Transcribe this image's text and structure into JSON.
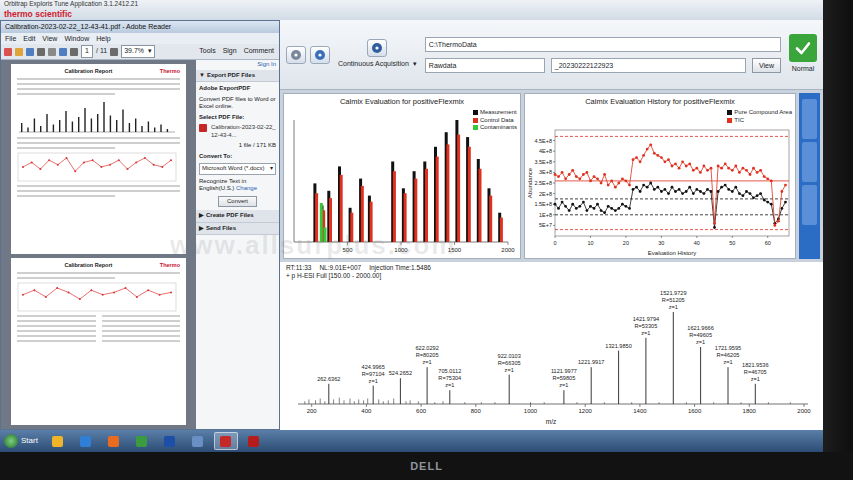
{
  "app": {
    "title": "Orbitrap Exploris Tune Application 3.1.2412.21",
    "logo": "thermo scientific",
    "toolbar": {
      "mode": "Continuous Acquisition",
      "mode_arrow": "▾",
      "path": "C:\\ThermoData",
      "file": "Rawdata",
      "suffix": "_20230222122923",
      "view_button": "View",
      "status": "Normal",
      "status_ok": true
    }
  },
  "reader": {
    "title": "Calibration-2023-02-22_12-43-41.pdf - Adobe Reader",
    "menu": [
      "File",
      "Edit",
      "View",
      "Window",
      "Help"
    ],
    "page": "1",
    "page_count": "/ 11",
    "zoom": "39.7%",
    "zoom_arrow": "▾",
    "tools": [
      "Tools",
      "Sign",
      "Comment"
    ],
    "pages": [
      {
        "title": "Calibration Report",
        "logo": "Thermo",
        "bars": [
          6,
          3,
          9,
          4,
          12,
          5,
          8,
          14,
          7,
          10,
          16,
          9,
          12,
          20,
          11,
          8,
          15,
          6,
          9,
          4,
          7,
          3,
          5,
          2
        ],
        "trend": [
          5,
          7,
          4,
          8,
          6,
          9,
          3,
          7,
          8,
          5,
          6,
          8,
          4,
          7,
          9,
          6,
          5,
          8
        ]
      },
      {
        "title": "Calibration Report",
        "logo": "Thermo",
        "bars": [],
        "trend": [
          6,
          8,
          5,
          9,
          7,
          4,
          8,
          6,
          7,
          9,
          5,
          8,
          6,
          7
        ]
      }
    ],
    "pane": {
      "sign_in": "Sign In",
      "sections": [
        {
          "label": "Export PDF Files",
          "arrow": "▼",
          "expanded": true
        },
        {
          "label": "Create PDF Files",
          "arrow": "▶",
          "expanded": false
        },
        {
          "label": "Send Files",
          "arrow": "▶",
          "expanded": false
        }
      ],
      "export": {
        "heading": "Adobe ExportPDF",
        "desc": "Convert PDF files to Word or Excel online.",
        "select_label": "Select PDF File:",
        "file": "Calibration-2023-02-22_12-43-4...",
        "file_info": "1 file / 171 KB",
        "convert_label": "Convert To:",
        "format": "Microsoft Word (*.docx)",
        "format_arrow": "▾",
        "recognize": "Recognize Text in English(U.S.)",
        "change": "Change",
        "button": "Convert"
      }
    }
  },
  "calmix": {
    "title": "Calmix Evaluation for positiveFlexmix",
    "x_ticks": [
      "500",
      "1000",
      "1500",
      "2000"
    ],
    "x_max": 2000,
    "y_max": 100,
    "series": [
      {
        "label": "Measurement",
        "color": "#111111",
        "points": [
          [
            195,
            48
          ],
          [
            262,
            30
          ],
          [
            325,
            42
          ],
          [
            425,
            62
          ],
          [
            524,
            28
          ],
          [
            622,
            52
          ],
          [
            705,
            38
          ],
          [
            922,
            66
          ],
          [
            1022,
            44
          ],
          [
            1122,
            58
          ],
          [
            1222,
            66
          ],
          [
            1322,
            78
          ],
          [
            1422,
            90
          ],
          [
            1522,
            100
          ],
          [
            1622,
            86
          ],
          [
            1722,
            68
          ],
          [
            1822,
            44
          ],
          [
            1922,
            24
          ]
        ]
      },
      {
        "label": "Control Data",
        "color": "#e0301e",
        "points": [
          [
            211,
            40
          ],
          [
            278,
            26
          ],
          [
            341,
            36
          ],
          [
            441,
            55
          ],
          [
            540,
            24
          ],
          [
            638,
            46
          ],
          [
            721,
            33
          ],
          [
            938,
            58
          ],
          [
            1038,
            40
          ],
          [
            1138,
            52
          ],
          [
            1238,
            60
          ],
          [
            1338,
            70
          ],
          [
            1438,
            80
          ],
          [
            1538,
            88
          ],
          [
            1638,
            78
          ],
          [
            1738,
            60
          ],
          [
            1838,
            38
          ],
          [
            1938,
            20
          ]
        ]
      },
      {
        "label": "Contaminants",
        "color": "#39c639",
        "points": [
          [
            255,
            32
          ],
          [
            290,
            12
          ]
        ]
      }
    ]
  },
  "history": {
    "title": "Calmix Evaluation History for positiveFlexmix",
    "y_label": "Abundance",
    "x_label": "Evaluation History",
    "y_ticks": [
      "4.5E+8",
      "4E+8",
      "3.5E+8",
      "3E+8",
      "2.5E+8",
      "2E+8",
      "1.5E+8",
      "1E+8",
      "5E+7"
    ],
    "y_max": 500000000.0,
    "x_ticks": [
      "0",
      "10",
      "20",
      "30",
      "40",
      "50",
      "60"
    ],
    "x_max": 66,
    "series": [
      {
        "label": "Pure Compound Area",
        "color": "#111111",
        "values": [
          150000000.0,
          130000000.0,
          160000000.0,
          140000000.0,
          120000000.0,
          150000000.0,
          130000000.0,
          140000000.0,
          160000000.0,
          120000000.0,
          140000000.0,
          130000000.0,
          150000000.0,
          120000000.0,
          110000000.0,
          140000000.0,
          130000000.0,
          120000000.0,
          130000000.0,
          150000000.0,
          140000000.0,
          130000000.0,
          220000000.0,
          230000000.0,
          210000000.0,
          240000000.0,
          230000000.0,
          250000000.0,
          220000000.0,
          230000000.0,
          210000000.0,
          220000000.0,
          200000000.0,
          230000000.0,
          210000000.0,
          220000000.0,
          200000000.0,
          210000000.0,
          230000000.0,
          200000000.0,
          220000000.0,
          210000000.0,
          200000000.0,
          220000000.0,
          210000000.0,
          40000000.0,
          210000000.0,
          230000000.0,
          240000000.0,
          220000000.0,
          210000000.0,
          230000000.0,
          200000000.0,
          190000000.0,
          210000000.0,
          200000000.0,
          180000000.0,
          190000000.0,
          200000000.0,
          170000000.0,
          160000000.0,
          150000000.0,
          60000000.0,
          80000000.0,
          130000000.0,
          160000000.0
        ]
      },
      {
        "label": "TIC",
        "color": "#e0301e",
        "values": [
          290000000.0,
          280000000.0,
          300000000.0,
          270000000.0,
          290000000.0,
          310000000.0,
          280000000.0,
          270000000.0,
          290000000.0,
          300000000.0,
          260000000.0,
          280000000.0,
          270000000.0,
          250000000.0,
          290000000.0,
          240000000.0,
          260000000.0,
          230000000.0,
          250000000.0,
          270000000.0,
          260000000.0,
          240000000.0,
          360000000.0,
          370000000.0,
          350000000.0,
          380000000.0,
          410000000.0,
          430000000.0,
          390000000.0,
          380000000.0,
          370000000.0,
          350000000.0,
          360000000.0,
          330000000.0,
          340000000.0,
          320000000.0,
          350000000.0,
          330000000.0,
          340000000.0,
          310000000.0,
          320000000.0,
          300000000.0,
          330000000.0,
          310000000.0,
          320000000.0,
          60000000.0,
          330000000.0,
          320000000.0,
          340000000.0,
          320000000.0,
          310000000.0,
          330000000.0,
          300000000.0,
          320000000.0,
          310000000.0,
          290000000.0,
          320000000.0,
          300000000.0,
          310000000.0,
          280000000.0,
          270000000.0,
          260000000.0,
          50000000.0,
          70000000.0,
          210000000.0,
          240000000.0
        ]
      }
    ],
    "limits": [
      {
        "value": 470000000.0,
        "series": 1,
        "dashed": true
      },
      {
        "value": 260000000.0,
        "series": 1,
        "dashed": false
      },
      {
        "value": 175000000.0,
        "series": 0,
        "dashed": true
      },
      {
        "value": 100000000.0,
        "series": 0,
        "dashed": true
      },
      {
        "value": 30000000.0,
        "series": 1,
        "dashed": true
      }
    ]
  },
  "spectrum": {
    "header": [
      "RT:11:33",
      "NL:9.01E+007",
      "Injection Time:1.5486"
    ],
    "scan": "+ p H-ESI Full [150.00 - 2000.00]",
    "x_min": 150,
    "x_max": 2000,
    "x_ticks": [
      "200",
      "400",
      "600",
      "800",
      "1000",
      "1200",
      "1400",
      "1600",
      "1800",
      "2000"
    ],
    "x_label": "m/z",
    "peaks": [
      {
        "mz": 262.6362,
        "rel": 22,
        "labels": [
          "262.6362"
        ]
      },
      {
        "mz": 424.9965,
        "rel": 20,
        "labels": [
          "424.9965",
          "R=97104",
          "z=1"
        ]
      },
      {
        "mz": 524.2652,
        "rel": 28,
        "labels": [
          "524.2652"
        ]
      },
      {
        "mz": 622.0292,
        "rel": 40,
        "labels": [
          "622.0292",
          "R=80205",
          "z=1"
        ]
      },
      {
        "mz": 705.0112,
        "rel": 15,
        "labels": [
          "705.0112",
          "R=75304",
          "z=1"
        ]
      },
      {
        "mz": 922.0103,
        "rel": 32,
        "labels": [
          "922.0103",
          "R=66305",
          "z=1"
        ]
      },
      {
        "mz": 1121.9977,
        "rel": 15,
        "labels": [
          "1121.9977",
          "R=59805",
          "z=1"
        ]
      },
      {
        "mz": 1221.9917,
        "rel": 40,
        "labels": [
          "1221.9917"
        ]
      },
      {
        "mz": 1321.985,
        "rel": 58,
        "labels": [
          "1321.9850"
        ]
      },
      {
        "mz": 1421.9794,
        "rel": 72,
        "labels": [
          "1421.9794",
          "R=53305",
          "z=1"
        ]
      },
      {
        "mz": 1521.9729,
        "rel": 100,
        "labels": [
          "1521.9729",
          "R=51205",
          "z=1"
        ]
      },
      {
        "mz": 1621.9666,
        "rel": 62,
        "labels": [
          "1621.9666",
          "R=49605",
          "z=1"
        ]
      },
      {
        "mz": 1721.9595,
        "rel": 40,
        "labels": [
          "1721.9595",
          "R=46205",
          "z=1"
        ]
      },
      {
        "mz": 1821.9536,
        "rel": 22,
        "labels": [
          "1821.9536",
          "R=46705",
          "z=1"
        ]
      }
    ],
    "minor": [
      [
        175,
        3
      ],
      [
        190,
        5
      ],
      [
        214,
        4
      ],
      [
        231,
        6
      ],
      [
        248,
        3
      ],
      [
        280,
        5
      ],
      [
        301,
        7
      ],
      [
        318,
        4
      ],
      [
        340,
        6
      ],
      [
        356,
        3
      ],
      [
        372,
        5
      ],
      [
        390,
        4
      ],
      [
        405,
        6
      ],
      [
        445,
        5
      ],
      [
        462,
        3
      ],
      [
        480,
        4
      ],
      [
        500,
        6
      ],
      [
        545,
        3
      ],
      [
        560,
        4
      ],
      [
        590,
        3
      ],
      [
        650,
        2
      ],
      [
        680,
        3
      ],
      [
        760,
        2
      ],
      [
        820,
        2
      ],
      [
        870,
        2
      ],
      [
        1000,
        2
      ],
      [
        1050,
        2
      ],
      [
        1170,
        2
      ],
      [
        1270,
        2
      ],
      [
        1370,
        2
      ],
      [
        1470,
        2
      ],
      [
        1570,
        2
      ],
      [
        1670,
        2
      ],
      [
        1770,
        2
      ],
      [
        1870,
        2
      ],
      [
        1950,
        2
      ]
    ]
  },
  "taskbar": {
    "start": "Start",
    "items": [
      {
        "color": "#f0b429",
        "active": false
      },
      {
        "color": "#2f7fd6",
        "active": false
      },
      {
        "color": "#e86b1f",
        "active": false
      },
      {
        "color": "#3a9b3f",
        "active": false
      },
      {
        "color": "#1d4fa8",
        "active": false
      },
      {
        "color": "#6a8fc4",
        "active": false
      },
      {
        "color": "#c62828",
        "active": true
      },
      {
        "color": "#b71c1c",
        "active": false
      }
    ]
  },
  "watermark": "www.allsurplus.com",
  "bezel": {
    "logo": "DELL"
  }
}
